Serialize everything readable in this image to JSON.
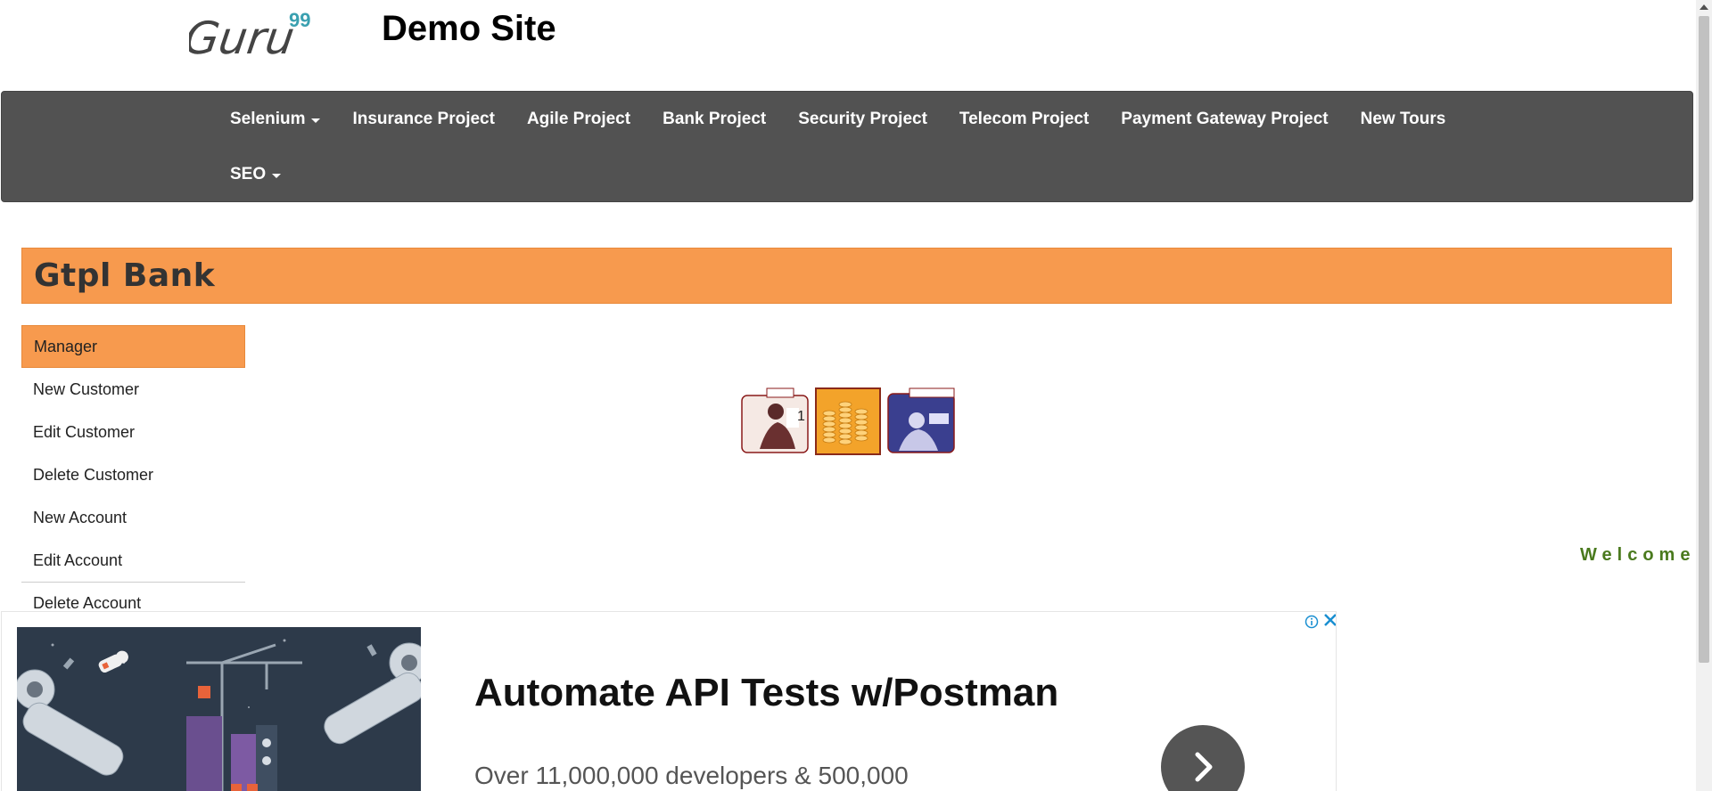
{
  "header": {
    "logo_text": "Guru",
    "logo_superscript": "99",
    "site_title": "Demo Site"
  },
  "navbar": {
    "row1": [
      {
        "label": "Selenium",
        "dropdown": true
      },
      {
        "label": "Insurance Project",
        "dropdown": false
      },
      {
        "label": "Agile Project",
        "dropdown": false
      },
      {
        "label": "Bank Project",
        "dropdown": false
      },
      {
        "label": "Security Project",
        "dropdown": false
      },
      {
        "label": "Telecom Project",
        "dropdown": false
      },
      {
        "label": "Payment Gateway Project",
        "dropdown": false
      },
      {
        "label": "New Tours",
        "dropdown": false
      }
    ],
    "row2": [
      {
        "label": "SEO",
        "dropdown": true
      }
    ]
  },
  "bank": {
    "title": "Gtpl Bank"
  },
  "sidebar": {
    "items": [
      {
        "label": "Manager",
        "active": true
      },
      {
        "label": "New Customer"
      },
      {
        "label": "Edit Customer"
      },
      {
        "label": "Delete Customer"
      },
      {
        "label": "New Account"
      },
      {
        "label": "Edit Account"
      },
      {
        "label": "Delete Account"
      }
    ]
  },
  "welcome": {
    "text": "Welcome"
  },
  "ad": {
    "headline": "Automate API Tests w/Postman",
    "subtext": "Over 11,000,000 developers & 500,000",
    "info_icon": "info-icon",
    "close_icon": "close-icon",
    "arrow_icon": "chevron-right-icon"
  },
  "colors": {
    "navbar_bg": "#525252",
    "accent_orange": "#f79a4e",
    "welcome_green": "#4a7a1e",
    "logo_teal": "#3aa0b0",
    "ad_link_blue": "#1a8fd1"
  }
}
